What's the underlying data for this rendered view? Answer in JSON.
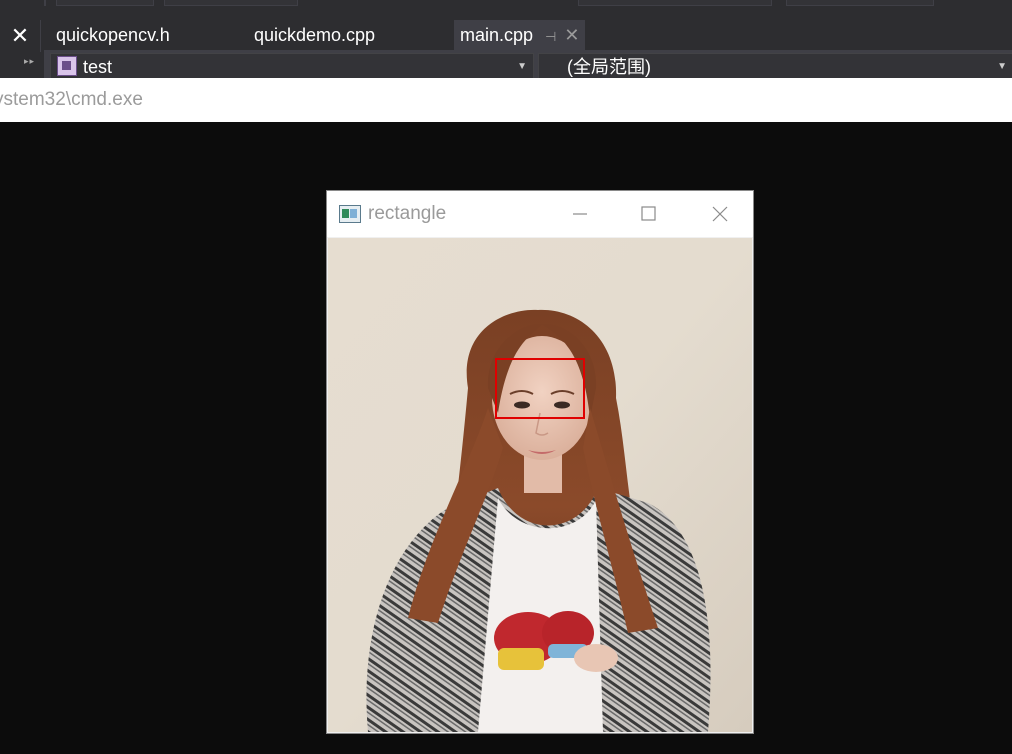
{
  "ide": {
    "tabs": [
      {
        "label": "quickopencv.h"
      },
      {
        "label": "quickdemo.cpp"
      },
      {
        "label": "main.cpp",
        "active": true
      }
    ],
    "active_tab_pin_icon": "pin-icon",
    "close_icon": "close-icon",
    "nav_left": {
      "label": "test",
      "icon": "project-icon"
    },
    "nav_right": {
      "label": "(全局范围)"
    }
  },
  "console": {
    "title": "ystem32\\cmd.exe"
  },
  "image_window": {
    "title": "rectangle",
    "buttons": [
      "minimize-icon",
      "maximize-icon",
      "close-icon"
    ],
    "overlay_rectangle_color": "#e00000"
  },
  "colors": {
    "ide_bg": "#2d2d30",
    "console_bg": "#0c0c0c",
    "rect_red": "#e00000"
  }
}
